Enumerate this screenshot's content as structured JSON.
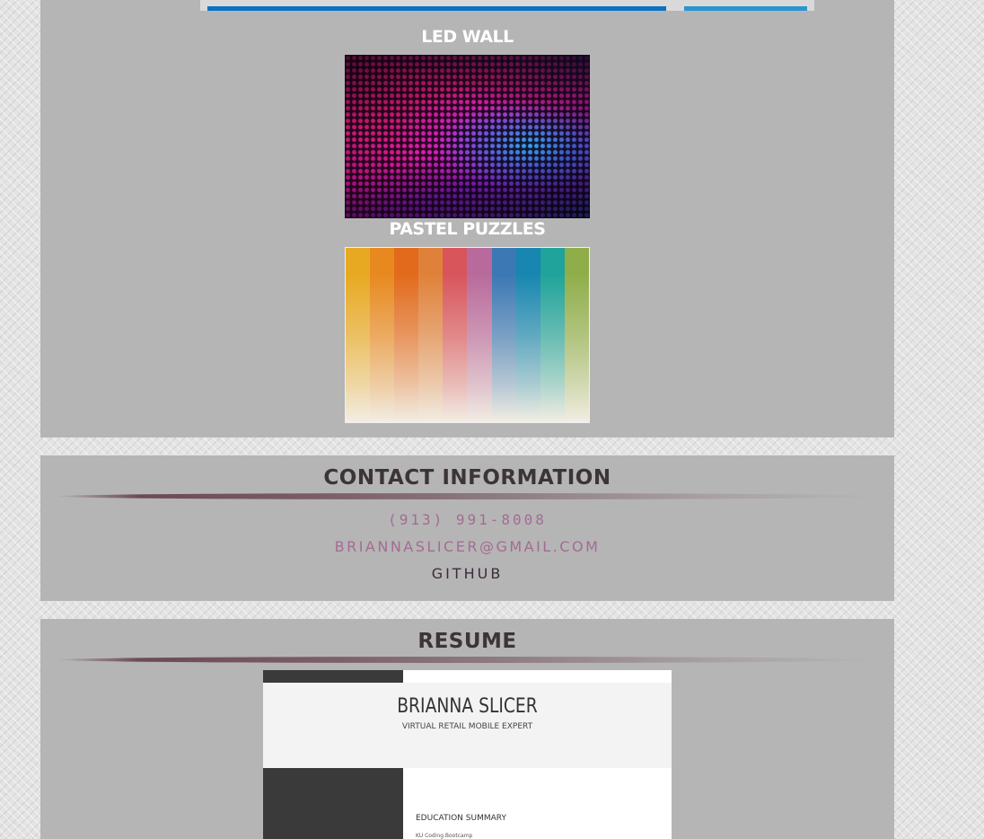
{
  "projects": {
    "led_wall": {
      "title": "LED WALL"
    },
    "pastel_puzzles": {
      "title": "PASTEL PUZZLES",
      "palette": [
        "#e8a922",
        "#e8891f",
        "#e26a1c",
        "#e0813a",
        "#d8555c",
        "#b96a9c",
        "#3b78b4",
        "#1786b0",
        "#1fa39a",
        "#8fae4a"
      ]
    }
  },
  "contact": {
    "heading": "CONTACT INFORMATION",
    "phone": "(913) 991-8008",
    "email": "BRIANNASLICER@GMAIL.COM",
    "github": "GITHUB"
  },
  "resume": {
    "heading": "RESUME",
    "name": "BRIANNA SLICER",
    "subtitle": "VIRTUAL RETAIL MOBILE EXPERT",
    "education_heading": "EDUCATION SUMMARY",
    "education_line": "KU Coding Bootcamp"
  },
  "colors": {
    "panel": "#b5b5b5",
    "contact_link": "#a56b92",
    "github_link": "#3e2a3a",
    "heading": "#3d3535"
  }
}
